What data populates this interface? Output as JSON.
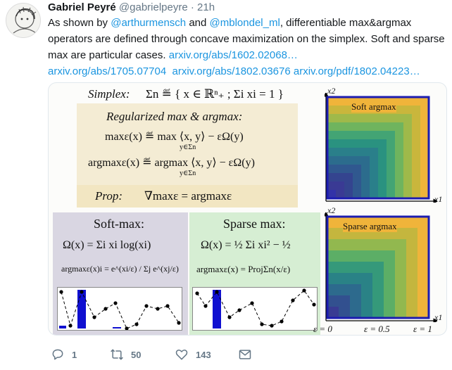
{
  "tweet": {
    "author_name": "Gabriel Peyré",
    "handle": "@gabrielpeyre",
    "separator": "·",
    "time": "21h",
    "text": {
      "t1": "As shown by ",
      "mention1": "@arthurmensch",
      "t2": " and ",
      "mention2": "@mblondel_ml",
      "t3": ", differentiable max&argmax operators are defined through concave maximization on the simplex. Soft and sparse max are particular cases. ",
      "link1": "arxiv.org/abs/1602.02068…",
      "link2": "arxiv.org/abs/1705.07704",
      "link3": "arxiv.org/abs/1802.03676",
      "link4": "arxiv.org/pdf/1802.04223…"
    }
  },
  "figure": {
    "simplex_label": "Simplex:",
    "simplex_formula": "Σn ≝ { x ∈ ℝⁿ₊ ; Σi xi = 1 }",
    "reg_title": "Regularized max & argmax:",
    "max_formula": "maxε(x) ≝ max ⟨x, y⟩ − εΩ(y)",
    "max_sub": "y∈Σn",
    "argmax_formula": "argmaxε(x) ≝ argmax ⟨x, y⟩ − εΩ(y)",
    "argmax_sub": "y∈Σn",
    "prop_label": "Prop:",
    "prop_formula": "∇maxε = argmaxε",
    "softmax_title": "Soft-max:",
    "softmax_omega": "Ω(x) = Σi xi log(xi)",
    "softmax_argmax": "argmaxε(x)i = e^(xi/ε) / Σj e^(xj/ε)",
    "sparsemax_title": "Sparse max:",
    "sparsemax_omega": "Ω(x) = ½ Σi xi² − ½",
    "sparsemax_argmax": "argmaxε(x) = ProjΣn(x/ε)",
    "soft_argmax_label": "Soft argmax",
    "sparse_argmax_label": "Sparse argmax",
    "x1_label": "x1",
    "x2_label": "x2",
    "eps_labels": [
      "ε = 0",
      "ε = 0.5",
      "ε = 1"
    ]
  },
  "actions": {
    "reply_count": "1",
    "retweet_count": "50",
    "like_count": "143"
  },
  "colors": {
    "link": "#1b95e0",
    "text_muted": "#657786",
    "heat_low": "#3b3f9c",
    "heat_high": "#f2b638",
    "border_blue": "#1c1cb0"
  }
}
